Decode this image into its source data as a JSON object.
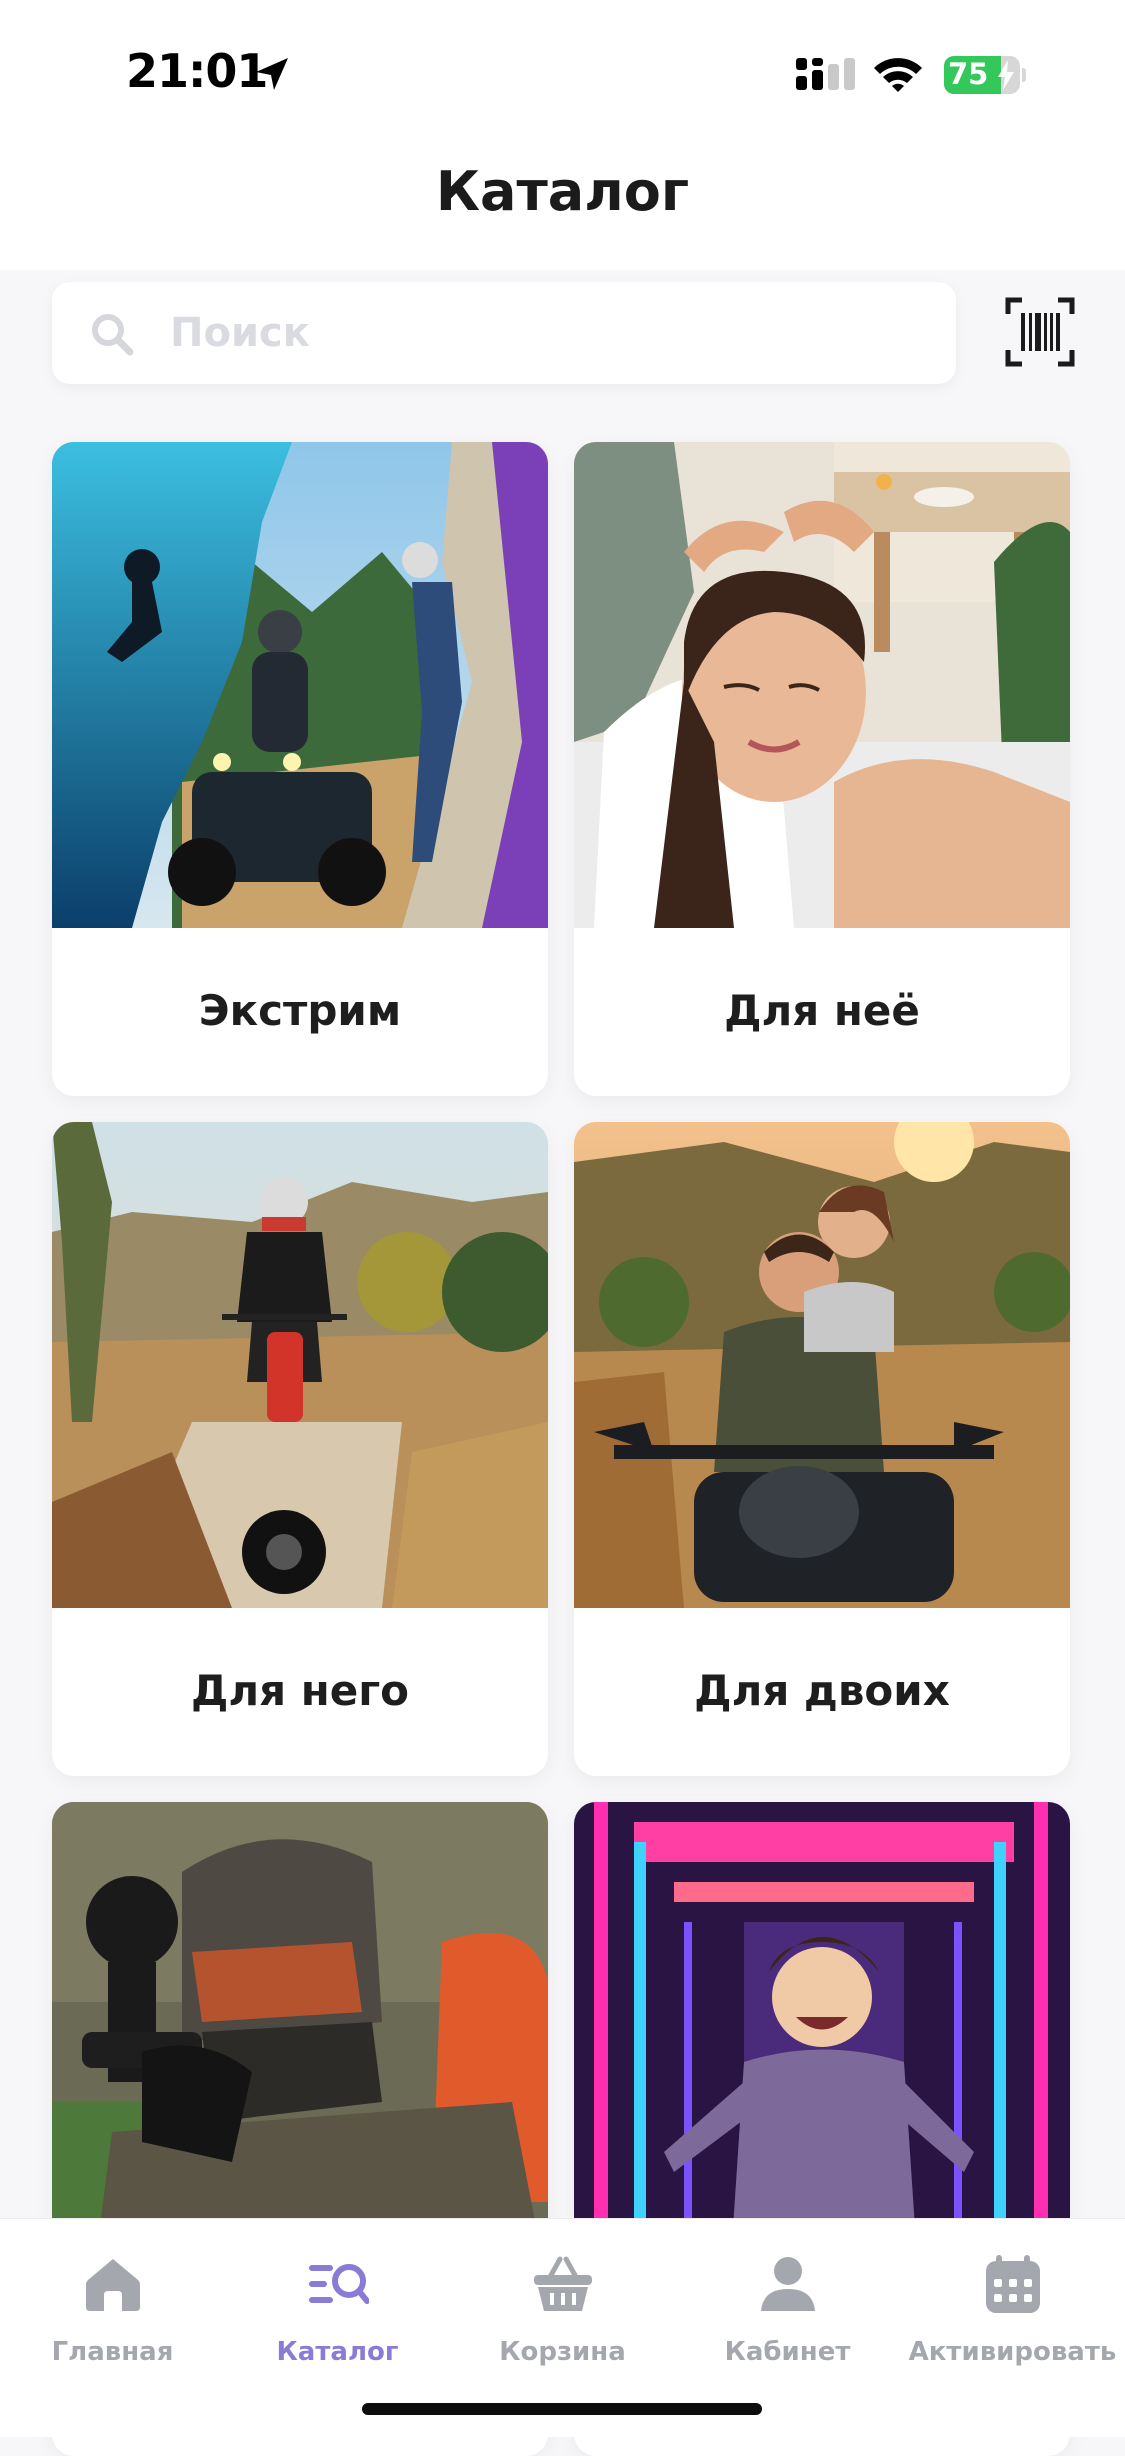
{
  "status_bar": {
    "time": "21:01",
    "battery_percent": "75",
    "battery_level": 0.75
  },
  "header": {
    "title": "Каталог"
  },
  "search": {
    "placeholder": "Поиск",
    "value": ""
  },
  "catalog": {
    "items": [
      {
        "label": "Экстрим",
        "image": "extreme-sports-collage"
      },
      {
        "label": "Для неё",
        "image": "woman-spa-massage"
      },
      {
        "label": "Для него",
        "image": "man-on-dirt-bike"
      },
      {
        "label": "Для двоих",
        "image": "couple-on-atv"
      },
      {
        "label": "",
        "image": "paintball-player"
      },
      {
        "label": "",
        "image": "child-in-neon-arcade"
      }
    ]
  },
  "tab_bar": {
    "active": "catalog",
    "accent_color": "#8b7bd6",
    "inactive_color": "#a4a7ad",
    "tabs": [
      {
        "id": "home",
        "label": "Главная",
        "icon": "home-icon"
      },
      {
        "id": "catalog",
        "label": "Каталог",
        "icon": "catalog-search-icon"
      },
      {
        "id": "cart",
        "label": "Корзина",
        "icon": "basket-icon"
      },
      {
        "id": "profile",
        "label": "Кабинет",
        "icon": "user-icon"
      },
      {
        "id": "activate",
        "label": "Активировать",
        "icon": "calendar-icon"
      }
    ]
  }
}
